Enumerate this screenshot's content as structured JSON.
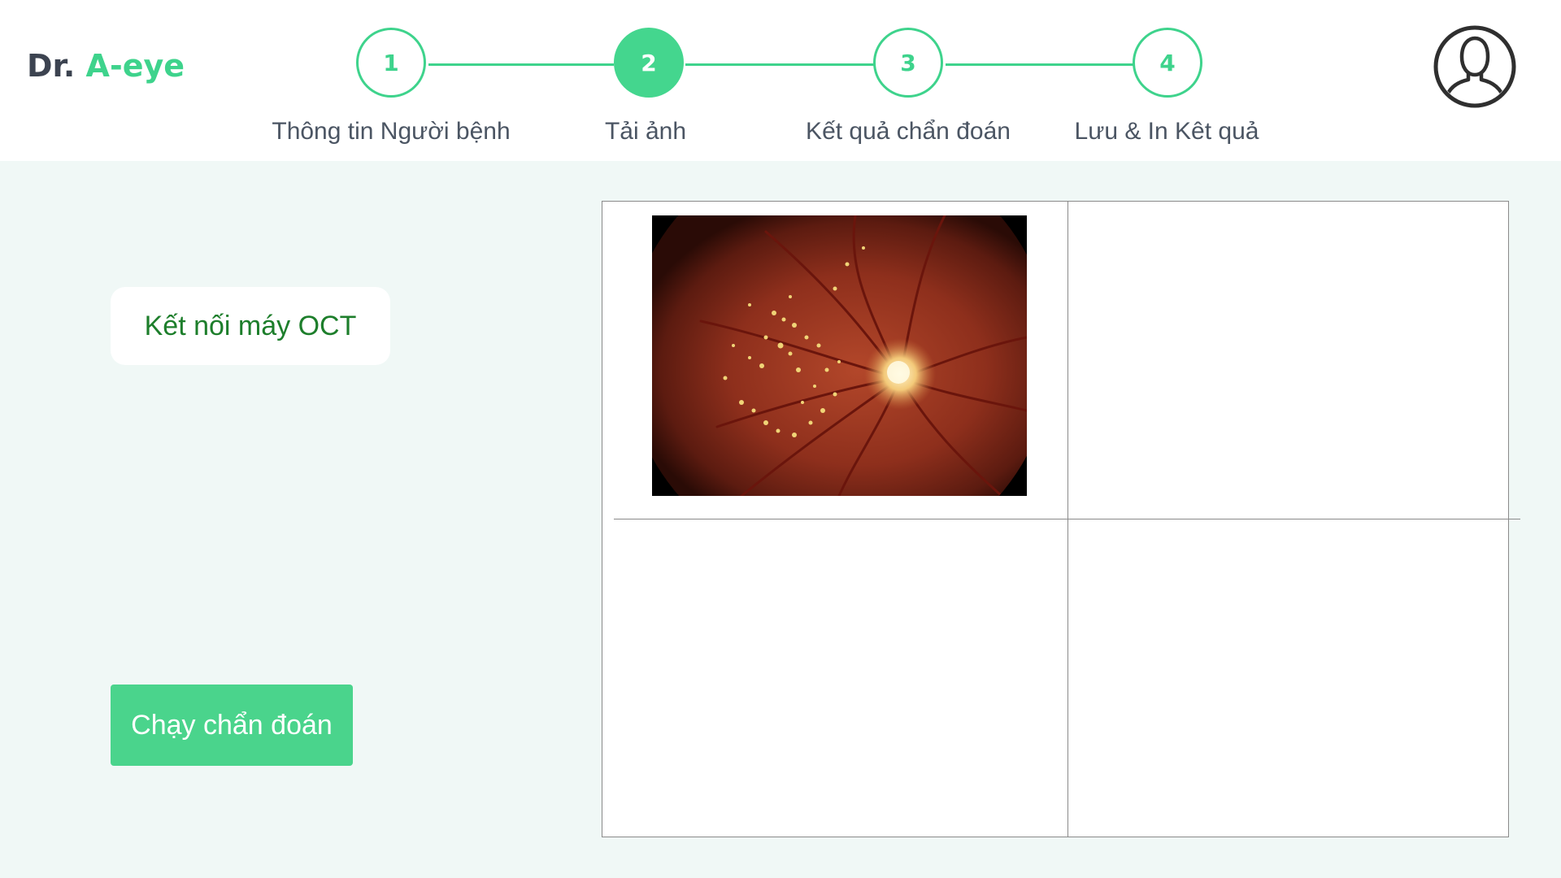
{
  "app": {
    "logo_prefix": "Dr.",
    "logo_brand": "A-eye"
  },
  "stepper": {
    "current_step": 2,
    "steps": [
      {
        "number": "1",
        "label": "Thông tin Người bệnh"
      },
      {
        "number": "2",
        "label": "Tải ảnh"
      },
      {
        "number": "3",
        "label": "Kết quả chẩn đoán"
      },
      {
        "number": "4",
        "label": "Lưu & In Kêt quả"
      }
    ]
  },
  "actions": {
    "oct_label": "Kết nối máy OCT",
    "run_label": "Chạy chẩn đoán"
  },
  "image_grid": {
    "slots": [
      {
        "filled": true,
        "content": "fundus-image"
      },
      {
        "filled": false
      },
      {
        "filled": false
      },
      {
        "filled": false
      }
    ]
  },
  "colors": {
    "accent": "#3ed38c",
    "active_step": "#44d68e",
    "run_button": "#4ad48c",
    "oct_text": "#1d7e2b",
    "background": "#f0f8f6"
  },
  "icons": {
    "avatar": "user-profile-icon"
  }
}
